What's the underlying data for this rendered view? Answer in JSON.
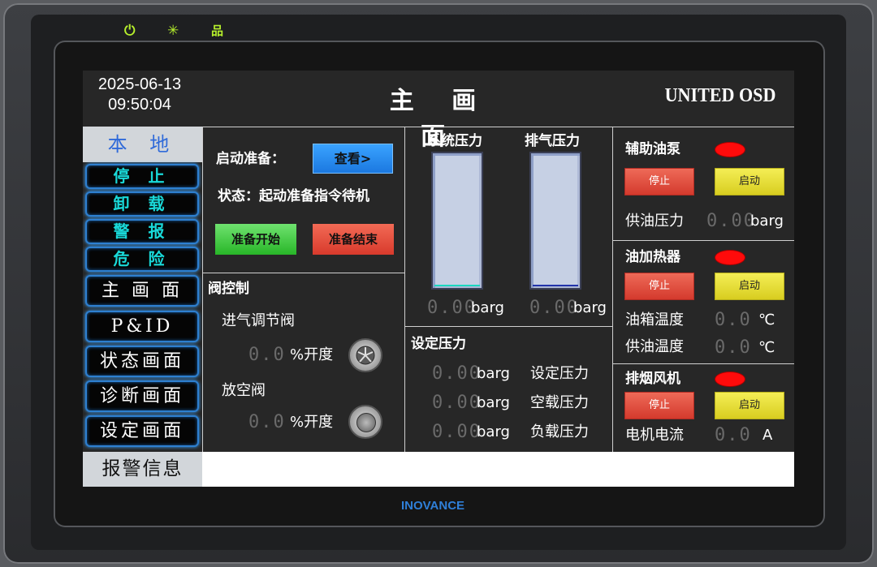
{
  "device": {
    "brand": "INOVANCE",
    "indicators": [
      "power-icon",
      "sun-icon",
      "network-icon"
    ]
  },
  "header": {
    "date": "2025-06-13",
    "time": "09:50:04",
    "title": "主 画 面",
    "brand": "UNITED OSD"
  },
  "nav": {
    "mode": "本 地",
    "alarm_buttons": [
      "停 止",
      "卸 载",
      "警 报",
      "危 险"
    ],
    "page_buttons": [
      "主 画 面",
      "P&ID",
      "状态画面",
      "诊断画面",
      "设定画面"
    ],
    "alarm_info": "报警信息"
  },
  "startup": {
    "label": "启动准备：",
    "view_button": "查看>",
    "status": "状态：起动准备指令待机",
    "start_button": "准备开始",
    "end_button": "准备结束"
  },
  "valves": {
    "title": "阀控制",
    "inlet_label": "进气调节阀",
    "inlet_value": "0.0",
    "inlet_unit": "%开度",
    "vent_label": "放空阀",
    "vent_value": "0.0",
    "vent_unit": "%开度"
  },
  "pressure": {
    "system_label": "系统压力",
    "exhaust_label": "排气压力",
    "system_value": "0.00",
    "exhaust_value": "0.00",
    "unit": "barg",
    "system_level": 0.0,
    "exhaust_level": 0.0
  },
  "setpoints": {
    "title": "设定压力",
    "rows": [
      {
        "value": "0.00",
        "unit": "barg",
        "label": "设定压力"
      },
      {
        "value": "0.00",
        "unit": "barg",
        "label": "空载压力"
      },
      {
        "value": "0.00",
        "unit": "barg",
        "label": "负载压力"
      }
    ]
  },
  "aux_pump": {
    "title": "辅助油泵",
    "stop": "停止",
    "start": "启动",
    "reading_label": "供油压力",
    "reading_value": "0.00",
    "reading_unit": "barg"
  },
  "oil_heater": {
    "title": "油加热器",
    "stop": "停止",
    "start": "启动",
    "tank_label": "油箱温度",
    "tank_value": "0.0",
    "tank_unit": "℃",
    "supply_label": "供油温度",
    "supply_value": "0.0",
    "supply_unit": "℃"
  },
  "exhaust_fan": {
    "title": "排烟风机",
    "stop": "停止",
    "start": "启动",
    "current_label": "电机电流",
    "current_value": "0.0",
    "current_unit": "A"
  },
  "colors": {
    "indicator_off": "#ff0b0b",
    "gauge_frame": "#c6d0e4",
    "system_fill": "#1bd7c0",
    "exhaust_fill": "#2233aa"
  }
}
